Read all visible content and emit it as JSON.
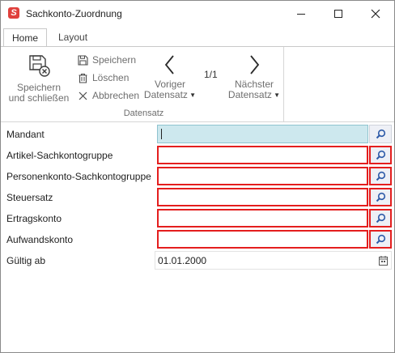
{
  "window": {
    "title": "Sachkonto-Zuordnung",
    "app_icon": "app-logo-icon",
    "controls": [
      "minimize-icon",
      "maximize-icon",
      "close-icon"
    ]
  },
  "tabs": [
    {
      "label": "Home",
      "active": true
    },
    {
      "label": "Layout",
      "active": false
    }
  ],
  "ribbon": {
    "group_label": "Datensatz",
    "save_close": {
      "line1": "Speichern",
      "line2": "und schließen",
      "icon": "save-close-icon"
    },
    "save": {
      "label": "Speichern",
      "icon": "save-icon"
    },
    "delete": {
      "label": "Löschen",
      "icon": "trash-icon"
    },
    "cancel": {
      "label": "Abbrechen",
      "icon": "close-icon"
    },
    "prev": {
      "line1": "Voriger",
      "line2": "Datensatz",
      "icon": "chevron-left-icon"
    },
    "next": {
      "line1": "Nächster",
      "line2": "Datensatz",
      "icon": "chevron-right-icon"
    },
    "counter": "1/1"
  },
  "form": {
    "fields": [
      {
        "label": "Mandant",
        "value": "",
        "state": "active",
        "lookup_icon": "search-icon"
      },
      {
        "label": "Artikel-Sachkontogruppe",
        "value": "",
        "state": "invalid",
        "lookup_icon": "search-icon"
      },
      {
        "label": "Personenkonto-Sachkontogruppe",
        "value": "",
        "state": "invalid",
        "lookup_icon": "search-icon"
      },
      {
        "label": "Steuersatz",
        "value": "",
        "state": "invalid",
        "lookup_icon": "search-icon"
      },
      {
        "label": "Ertragskonto",
        "value": "",
        "state": "invalid",
        "lookup_icon": "search-icon"
      },
      {
        "label": "Aufwandskonto",
        "value": "",
        "state": "invalid",
        "lookup_icon": "search-icon"
      }
    ],
    "valid_from": {
      "label": "Gültig ab",
      "value": "01.01.2000",
      "icon": "calendar-icon"
    }
  },
  "colors": {
    "error": "#e41e1e",
    "active_field": "#cde8ee",
    "lookup_bg": "#eef0f6",
    "lookup_icon": "#2d5aa8"
  }
}
